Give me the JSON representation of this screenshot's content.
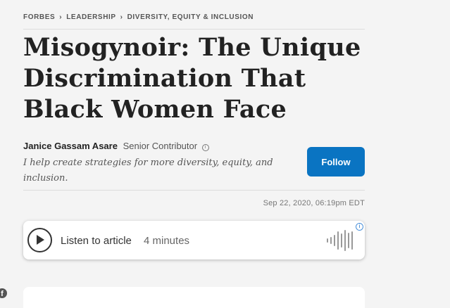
{
  "breadcrumb": {
    "items": [
      "FORBES",
      "LEADERSHIP",
      "DIVERSITY, EQUITY & INCLUSION"
    ],
    "separator": "›"
  },
  "article": {
    "title": "Misogynoir: The Unique Discrimination That Black Women Face",
    "date": "Sep 22, 2020, 06:19pm EDT"
  },
  "author": {
    "name": "Janice Gassam Asare",
    "role": "Senior Contributor",
    "bio": "I help create strategies for more diversity, equity, and inclusion.",
    "follow_label": "Follow"
  },
  "audio": {
    "listen_label": "Listen to article",
    "duration": "4 minutes"
  },
  "colors": {
    "follow_button": "#0a74c2",
    "page_background": "#f4f4f4"
  },
  "icons": [
    "chevron-right-icon",
    "info-icon",
    "play-icon",
    "waveform-icon",
    "ad-info-icon",
    "facebook-icon"
  ]
}
